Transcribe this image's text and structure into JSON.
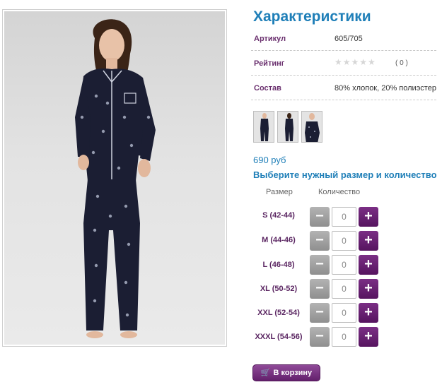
{
  "photo": {
    "alt": "",
    "icon": "product-photo"
  },
  "specs": {
    "title": "Характеристики",
    "article_label": "Артикул",
    "article_value": "605/705",
    "rating_label": "Рейтинг",
    "rating_stars": "★★★★★",
    "rating_value": 0,
    "rating_max": 5,
    "rating_count": "( 0 )",
    "composition_label": "Состав",
    "composition_value": "80% хлопок, 20% полиэстер"
  },
  "thumbnails": [
    {
      "name": "thumbnail-1"
    },
    {
      "name": "thumbnail-2"
    },
    {
      "name": "thumbnail-3"
    }
  ],
  "price": "690 руб",
  "order": {
    "title": "Выберите нужный размер и количество",
    "size_header": "Размер",
    "qty_header": "Количество",
    "minus": "−",
    "plus": "+",
    "sizes": [
      {
        "label": "S (42-44)",
        "qty": "0"
      },
      {
        "label": "M (44-46)",
        "qty": "0"
      },
      {
        "label": "L (46-48)",
        "qty": "0"
      },
      {
        "label": "XL (50-52)",
        "qty": "0"
      },
      {
        "label": "XXL (52-54)",
        "qty": "0"
      },
      {
        "label": "XXXL (54-56)",
        "qty": "0"
      }
    ]
  },
  "cart": {
    "label": "В корзину",
    "icon": "cart-icon"
  },
  "colors": {
    "heading": "#1f7fb8",
    "label": "#6a2f6e",
    "plus_button": "#6b2276",
    "minus_button": "#a3a3a3"
  }
}
